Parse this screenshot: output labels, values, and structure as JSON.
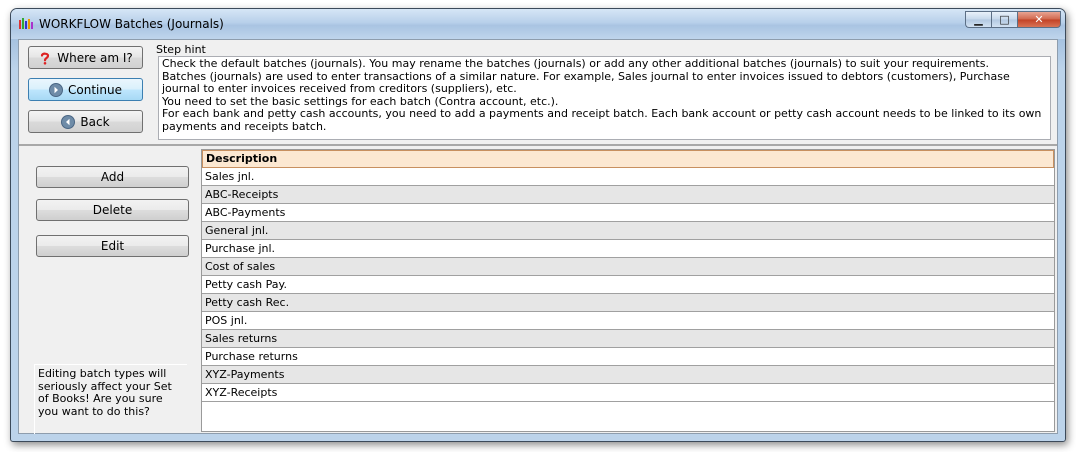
{
  "window": {
    "title": "WORKFLOW Batches (Journals)",
    "caption_buttons": {
      "minimize": "▁",
      "maximize": "□",
      "close": "✕"
    }
  },
  "nav": {
    "where_am_i": "Where am I?",
    "continue": "Continue",
    "back": "Back"
  },
  "step_hint": {
    "label": "Step hint",
    "lines": [
      "Check the default batches (journals). You may rename the batches (journals) or add any other additional batches (journals) to suit your requirements.",
      "Batches (journals) are used to enter transactions of a similar nature. For example, Sales journal to enter invoices issued to debtors (customers), Purchase journal to enter invoices received from creditors (suppliers), etc.",
      "You need to set the basic settings for each batch (Contra account, etc.).",
      "For each bank and petty cash accounts, you need to add a payments and receipt batch. Each bank account or petty cash account needs to be linked to its own payments and receipts batch."
    ]
  },
  "actions": {
    "add": "Add",
    "delete": "Delete",
    "edit": "Edit"
  },
  "warning": "Editing batch types will seriously affect your Set of Books! Are you sure you want to do this?",
  "grid": {
    "header": "Description",
    "rows": [
      "Sales jnl.",
      "ABC-Receipts",
      "ABC-Payments",
      "General jnl.",
      "Purchase jnl.",
      "Cost of sales",
      "Petty cash Pay.",
      "Petty cash Rec.",
      "POS jnl.",
      "Sales returns",
      "Purchase returns",
      "XYZ-Payments",
      "XYZ-Receipts"
    ]
  },
  "icons": {
    "app": "batches-app-icon",
    "where_am_i": "question-mark-icon",
    "continue": "arrow-right-circle-icon",
    "back": "arrow-left-circle-icon"
  },
  "colors": {
    "grid_header_bg": "#fce8d2",
    "active_button": "#bee6fd",
    "close_button": "#c24125"
  }
}
